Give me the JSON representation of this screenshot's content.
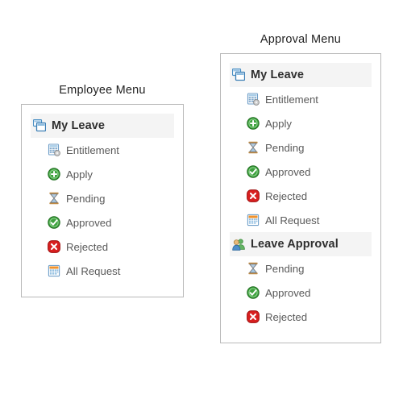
{
  "employee_panel": {
    "title": "Employee Menu",
    "sections": [
      {
        "header": {
          "label": "My Leave",
          "icon": "stacked-windows-icon"
        },
        "items": [
          {
            "label": "Entitlement",
            "icon": "spreadsheet-gear-icon"
          },
          {
            "label": "Apply",
            "icon": "green-plus-circle-icon"
          },
          {
            "label": "Pending",
            "icon": "hourglass-icon"
          },
          {
            "label": "Approved",
            "icon": "green-check-circle-icon"
          },
          {
            "label": "Rejected",
            "icon": "red-x-circle-icon"
          },
          {
            "label": "All Request",
            "icon": "calendar-icon"
          }
        ]
      }
    ]
  },
  "approval_panel": {
    "title": "Approval Menu",
    "sections": [
      {
        "header": {
          "label": "My Leave",
          "icon": "stacked-windows-icon"
        },
        "items": [
          {
            "label": "Entitlement",
            "icon": "spreadsheet-gear-icon"
          },
          {
            "label": "Apply",
            "icon": "green-plus-circle-icon"
          },
          {
            "label": "Pending",
            "icon": "hourglass-icon"
          },
          {
            "label": "Approved",
            "icon": "green-check-circle-icon"
          },
          {
            "label": "Rejected",
            "icon": "red-x-circle-icon"
          },
          {
            "label": "All Request",
            "icon": "calendar-icon"
          }
        ]
      },
      {
        "header": {
          "label": "Leave Approval",
          "icon": "two-people-icon"
        },
        "items": [
          {
            "label": "Pending",
            "icon": "hourglass-icon"
          },
          {
            "label": "Approved",
            "icon": "green-check-circle-icon"
          },
          {
            "label": "Rejected",
            "icon": "red-x-circle-icon"
          }
        ]
      }
    ]
  },
  "colors": {
    "panel_border": "#b9b9b9",
    "header_band": "#f4f4f4",
    "header_text": "#2f2f2f",
    "item_text": "#5a5a5a",
    "title_text": "#222222",
    "green": "#3aa03a",
    "red": "#d81f1f",
    "blue": "#4a8fc4",
    "orange": "#f0922b"
  }
}
